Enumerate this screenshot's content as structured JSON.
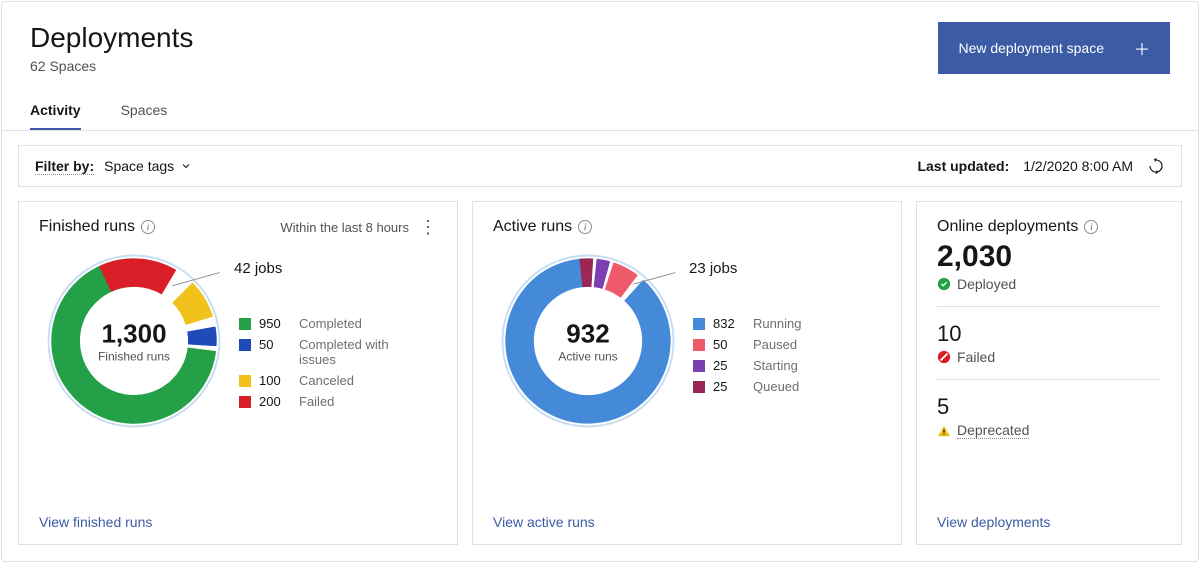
{
  "header": {
    "title": "Deployments",
    "subtitle": "62 Spaces",
    "new_button": "New deployment space"
  },
  "tabs": [
    {
      "label": "Activity",
      "active": true
    },
    {
      "label": "Spaces",
      "active": false
    }
  ],
  "filter": {
    "label": "Filter by:",
    "dropdown": "Space tags"
  },
  "updated": {
    "label": "Last updated:",
    "value": "1/2/2020 8:00 AM"
  },
  "finished": {
    "title": "Finished runs",
    "range": "Within the last 8 hours",
    "total_display": "1,300",
    "total_sub": "Finished runs",
    "jobs_callout": "42 jobs",
    "legend": [
      {
        "value": "950",
        "label": "Completed",
        "color": "#24a148"
      },
      {
        "value": "50",
        "label": "Completed with issues",
        "color": "#1e4bb8"
      },
      {
        "value": "100",
        "label": "Canceled",
        "color": "#f1c21b"
      },
      {
        "value": "200",
        "label": "Failed",
        "color": "#da1e28"
      }
    ],
    "view": "View finished runs"
  },
  "active": {
    "title": "Active runs",
    "total_display": "932",
    "total_sub": "Active runs",
    "jobs_callout": "23 jobs",
    "legend": [
      {
        "value": "832",
        "label": "Running",
        "color": "#4589d9"
      },
      {
        "value": "50",
        "label": "Paused",
        "color": "#ef5a6b"
      },
      {
        "value": "25",
        "label": "Starting",
        "color": "#7b3fb2"
      },
      {
        "value": "25",
        "label": "Queued",
        "color": "#9c2656"
      }
    ],
    "view": "View active runs"
  },
  "online": {
    "title": "Online deployments",
    "deployed_value": "2,030",
    "deployed_label": "Deployed",
    "failed_value": "10",
    "failed_label": "Failed",
    "deprecated_value": "5",
    "deprecated_label": "Deprecated",
    "view": "View deployments"
  },
  "chart_data": [
    {
      "type": "pie",
      "title": "Finished runs",
      "categories": [
        "Completed",
        "Completed with issues",
        "Canceled",
        "Failed"
      ],
      "values": [
        950,
        50,
        100,
        200
      ],
      "total": 1300,
      "jobs": 42
    },
    {
      "type": "pie",
      "title": "Active runs",
      "categories": [
        "Running",
        "Paused",
        "Starting",
        "Queued"
      ],
      "values": [
        832,
        50,
        25,
        25
      ],
      "total": 932,
      "jobs": 23
    }
  ]
}
